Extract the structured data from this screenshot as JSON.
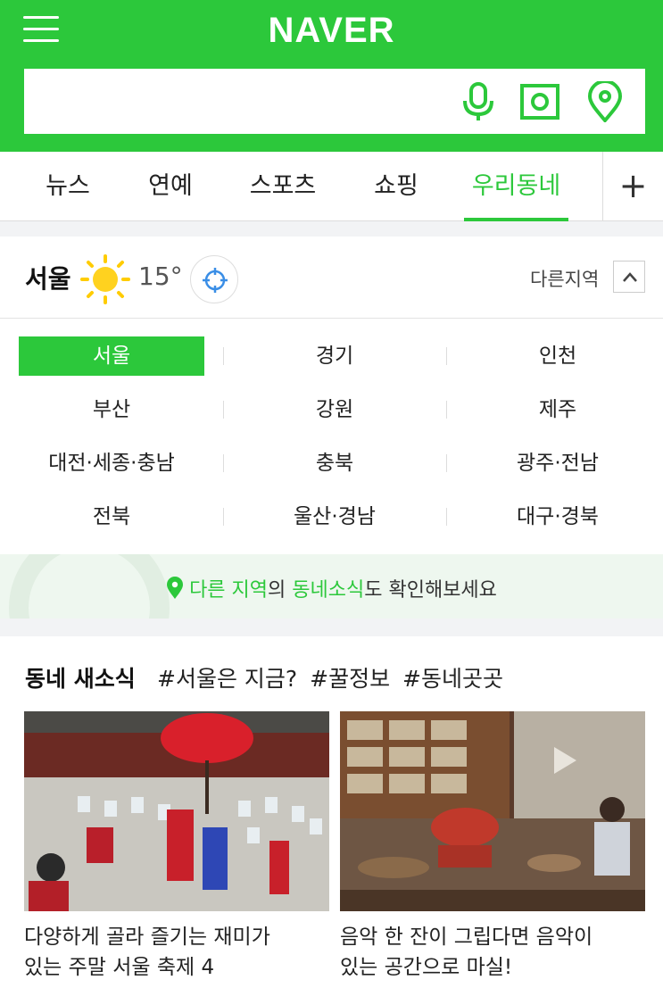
{
  "header": {
    "logo": "NAVER",
    "menu_icon": "hamburger-menu-icon",
    "search": {
      "value": "",
      "placeholder": ""
    },
    "icons": [
      "microphone-icon",
      "camera-lens-icon",
      "location-pin-icon"
    ],
    "brand_color": "#2cc83b"
  },
  "tabs": [
    {
      "label": "뉴스",
      "active": false
    },
    {
      "label": "연예",
      "active": false
    },
    {
      "label": "스포츠",
      "active": false
    },
    {
      "label": "쇼핑",
      "active": false
    },
    {
      "label": "우리동네",
      "active": true
    }
  ],
  "tabs_more_label": "+",
  "weather": {
    "city": "서울",
    "condition_icon": "sun-icon",
    "temperature": "15°",
    "other_region_label": "다른지역"
  },
  "regions": [
    {
      "label": "서울",
      "selected": true
    },
    {
      "label": "경기",
      "selected": false
    },
    {
      "label": "인천",
      "selected": false
    },
    {
      "label": "부산",
      "selected": false
    },
    {
      "label": "강원",
      "selected": false
    },
    {
      "label": "제주",
      "selected": false
    },
    {
      "label": "대전·세종·충남",
      "selected": false
    },
    {
      "label": "충북",
      "selected": false
    },
    {
      "label": "광주·전남",
      "selected": false
    },
    {
      "label": "전북",
      "selected": false
    },
    {
      "label": "울산·경남",
      "selected": false
    },
    {
      "label": "대구·경북",
      "selected": false
    }
  ],
  "hint": {
    "part1": "다른 지역",
    "part2": "의 ",
    "part3": "동네소식",
    "part4": "도 확인해보세요"
  },
  "news": {
    "title": "동네 새소식",
    "tags": [
      "#서울은 지금?",
      "#꿀정보",
      "#동네곳곳"
    ],
    "articles": [
      {
        "title_line1": "다양하게 골라 즐기는 재미가",
        "title_line2": "있는 주말 서울 축제 4"
      },
      {
        "title_line1": "음악 한 잔이 그립다면 음악이",
        "title_line2": "있는 공간으로 마실!"
      }
    ]
  }
}
